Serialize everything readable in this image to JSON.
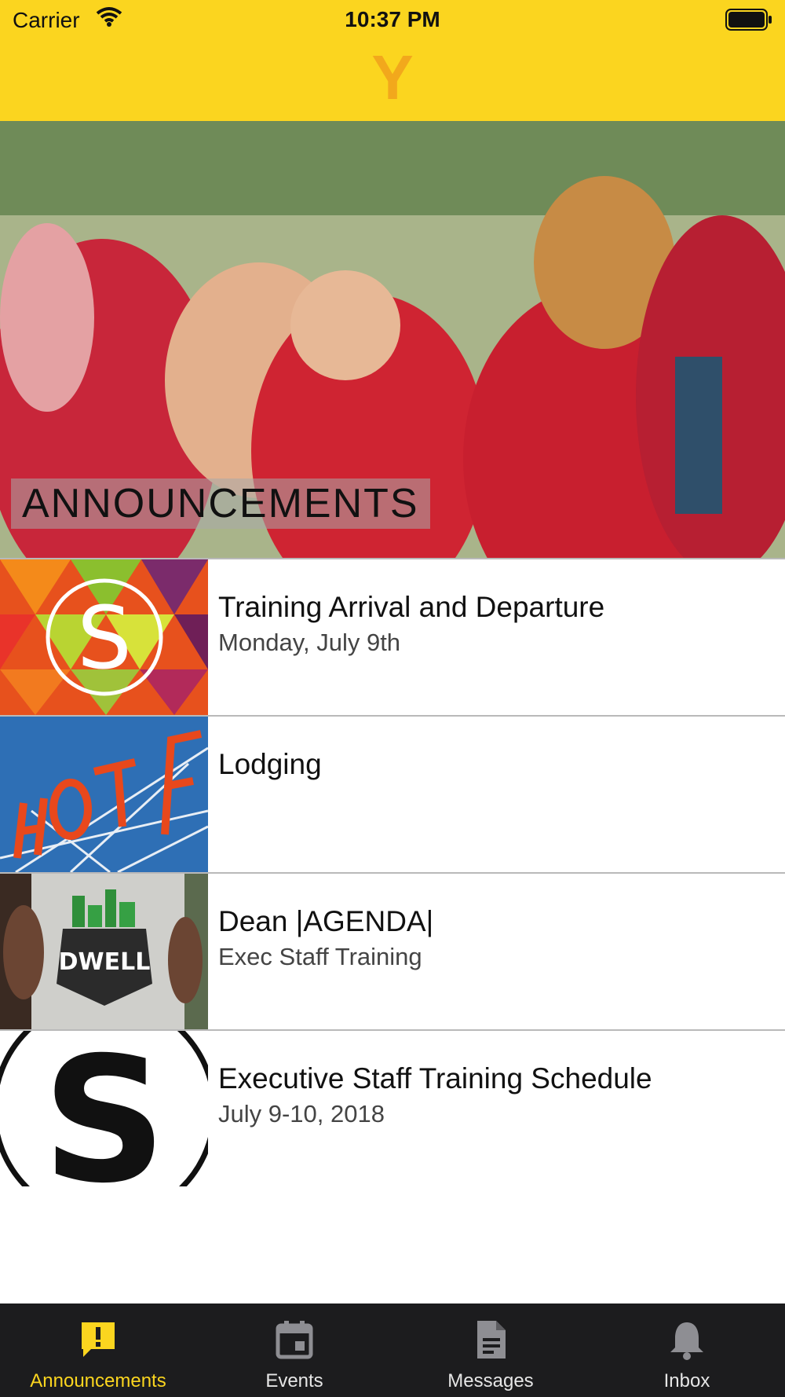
{
  "status_bar": {
    "carrier": "Carrier",
    "time": "10:37 PM"
  },
  "nav": {
    "logo": "Y"
  },
  "hero": {
    "banner_text": "ANNOUNCEMENTS"
  },
  "announcements": [
    {
      "title": "Training Arrival and Departure",
      "subtitle": "Monday, July 9th",
      "thumb_icon": "s-logo-icon"
    },
    {
      "title": "Lodging",
      "subtitle": "",
      "thumb_icon": "hotel-sign-icon"
    },
    {
      "title": "Dean |AGENDA|",
      "subtitle": "Exec Staff Training",
      "thumb_icon": "dwell-logo-icon"
    },
    {
      "title": "Executive Staff Training Schedule",
      "subtitle": "July 9-10, 2018",
      "thumb_icon": "s-circle-logo-icon"
    }
  ],
  "tabs": [
    {
      "label": "Announcements",
      "icon": "announcement-icon",
      "active": true
    },
    {
      "label": "Events",
      "icon": "calendar-icon",
      "active": false
    },
    {
      "label": "Messages",
      "icon": "document-icon",
      "active": false
    },
    {
      "label": "Inbox",
      "icon": "bell-icon",
      "active": false
    }
  ],
  "colors": {
    "brand_yellow": "#fbd51f",
    "logo_orange": "#f2a81c",
    "tab_bar_bg": "#1c1c1e"
  }
}
